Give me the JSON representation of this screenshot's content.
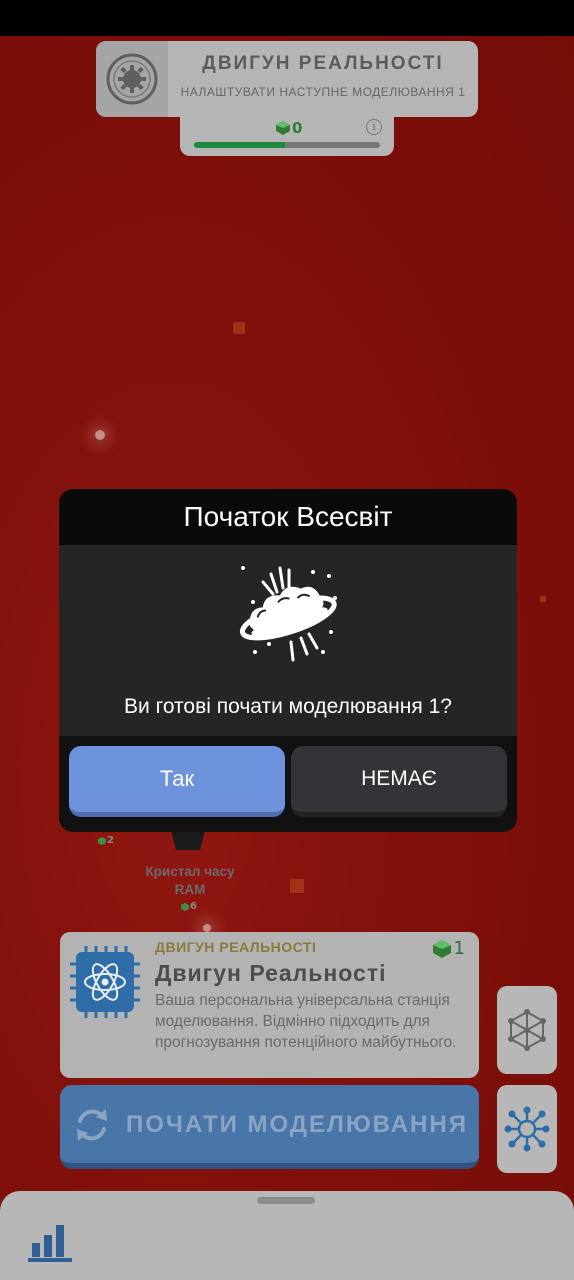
{
  "header": {
    "title": "ДВИГУН РЕАЛЬНОСТІ",
    "subtitle": "НАЛАШТУВАТИ НАСТУПНЕ МОДЕЛЮВАННЯ 1",
    "gem_count": "0",
    "progress": 0.49
  },
  "map": {
    "node_label_line1": "Кристал часу",
    "node_label_line2": "RAM",
    "node_cost_a": "2",
    "node_cost_b": "6"
  },
  "modal": {
    "title": "Початок Всесвіт",
    "question": "Ви готові почати моделювання 1?",
    "yes_label": "Так",
    "no_label": "НЕМАЄ"
  },
  "info_card": {
    "subtitle": "ДВИГУН РЕАЛЬНОСТІ",
    "gem_count": "1",
    "title": "Двигун Реальності",
    "description": "Ваша персональна універсальна станція моделювання. Відмінно підходить для прогнозування потенційного майбутнього."
  },
  "start_button": {
    "label": "ПОЧАТИ МОДЕЛЮВАННЯ"
  },
  "icons": {
    "header": "gear-icon",
    "modal": "big-bang-icon",
    "info": "atom-chip-icon",
    "side_top": "network-icon",
    "side_bottom": "hub-icon",
    "start": "refresh-icon",
    "bottom": "bar-chart-icon"
  },
  "colors": {
    "background": "#a3150e",
    "yes_button": "#6d93dd",
    "no_button": "#333338",
    "start_button": "#4876a8",
    "progress_fill": "#1f8a3d"
  }
}
